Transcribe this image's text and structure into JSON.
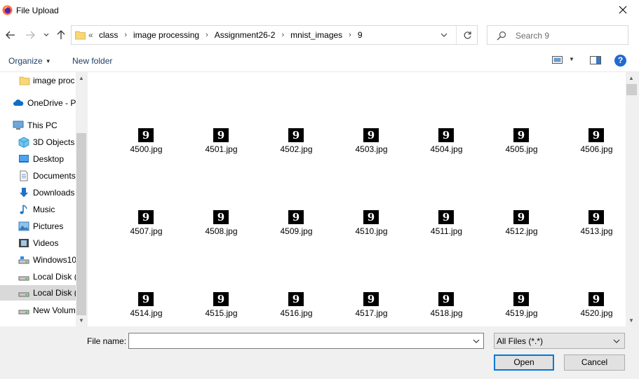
{
  "window": {
    "title": "File Upload"
  },
  "nav": {
    "breadcrumbs": [
      "class",
      "image processing",
      "Assignment26-2",
      "mnist_images",
      "9"
    ],
    "overflow_chevron": "«",
    "search_placeholder": "Search 9"
  },
  "toolbar": {
    "organize": "Organize",
    "new_folder": "New folder",
    "help": "?"
  },
  "sidebar": {
    "items": [
      {
        "label": "image proc",
        "icon": "folder-icon"
      },
      {
        "label": "OneDrive - P",
        "icon": "cloud-icon"
      },
      {
        "label": "This PC",
        "icon": "computer-icon"
      },
      {
        "label": "3D Objects",
        "icon": "cube-icon"
      },
      {
        "label": "Desktop",
        "icon": "desktop-icon"
      },
      {
        "label": "Documents",
        "icon": "document-icon"
      },
      {
        "label": "Downloads",
        "icon": "download-icon"
      },
      {
        "label": "Music",
        "icon": "music-icon"
      },
      {
        "label": "Pictures",
        "icon": "pictures-icon"
      },
      {
        "label": "Videos",
        "icon": "video-icon"
      },
      {
        "label": "Windows10",
        "icon": "drive-icon"
      },
      {
        "label": "Local Disk (",
        "icon": "drive-icon"
      },
      {
        "label": "Local Disk (",
        "icon": "drive-icon",
        "selected": true
      },
      {
        "label": "New Volum",
        "icon": "drive-icon"
      }
    ]
  },
  "files": [
    "4500.jpg",
    "4501.jpg",
    "4502.jpg",
    "4503.jpg",
    "4504.jpg",
    "4505.jpg",
    "4506.jpg",
    "4507.jpg",
    "4508.jpg",
    "4509.jpg",
    "4510.jpg",
    "4511.jpg",
    "4512.jpg",
    "4513.jpg",
    "4514.jpg",
    "4515.jpg",
    "4516.jpg",
    "4517.jpg",
    "4518.jpg",
    "4519.jpg",
    "4520.jpg"
  ],
  "bottom": {
    "file_name_label": "File name:",
    "file_name_value": "",
    "file_type": "All Files (*.*)",
    "open_label": "Open",
    "cancel_label": "Cancel"
  },
  "colors": {
    "accent": "#0078d7",
    "link": "#1e3f66",
    "folder": "#f8d775",
    "selection": "#d9d9d9"
  }
}
